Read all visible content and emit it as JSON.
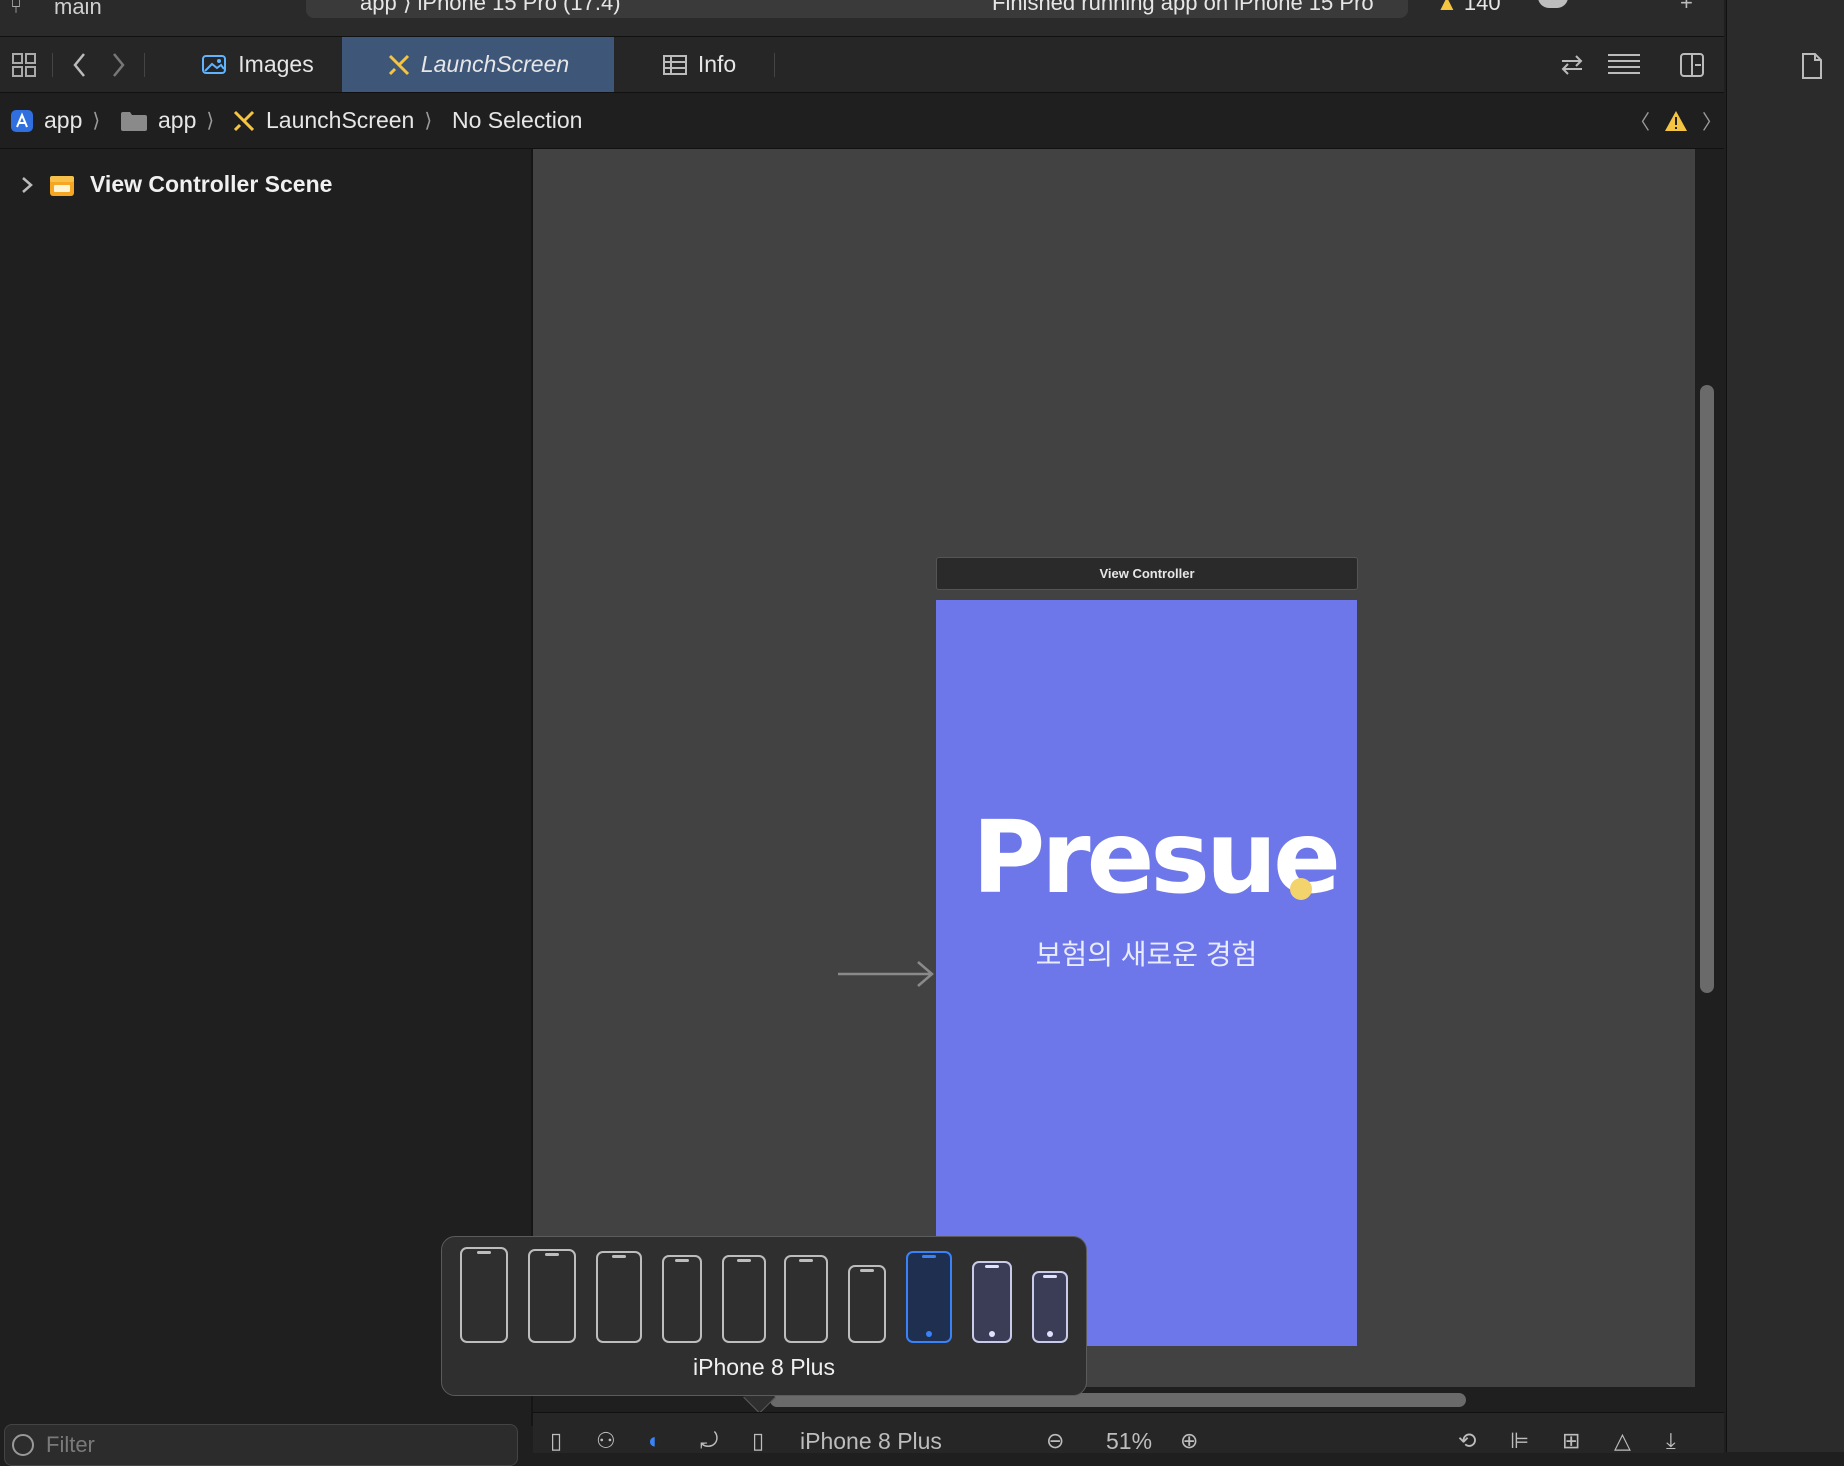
{
  "toolbar": {
    "branch": "main",
    "scheme": "app ⟩ iPhone 15 Pro (17.4)",
    "run_status": "Finished running app on iPhone 15 Pro",
    "warning_count": "140"
  },
  "tabs": [
    {
      "label": "Images",
      "icon": "photo-icon"
    },
    {
      "label": "LaunchScreen",
      "icon": "storyboard-icon",
      "active": true
    },
    {
      "label": "Info",
      "icon": "table-icon"
    }
  ],
  "breadcrumb": {
    "project": "app",
    "folder": "app",
    "file": "LaunchScreen",
    "selection": "No Selection"
  },
  "outline": {
    "scene_label": "View Controller Scene"
  },
  "canvas": {
    "view_controller_title": "View Controller",
    "app_logo_text": "Presue",
    "tagline": "보험의 새로운 경험",
    "screen_color": "#6d77ea",
    "accent_dot_color": "#f3d36c"
  },
  "device_popover": {
    "selected_label": "iPhone 8 Plus",
    "selected_index": 7,
    "selection_color": "#3a82f7"
  },
  "bottom_bar": {
    "filter_placeholder": "Filter",
    "device_name": "iPhone 8 Plus",
    "zoom": "51%"
  }
}
